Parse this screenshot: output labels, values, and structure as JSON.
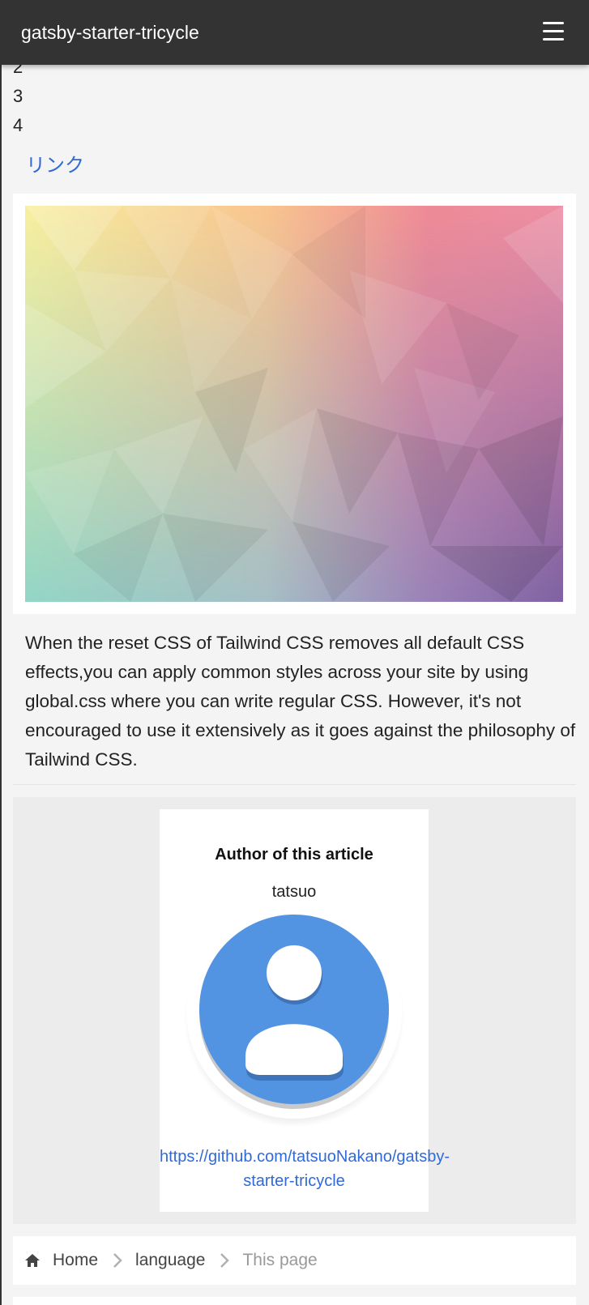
{
  "header": {
    "site_title": "gatsby-starter-tricycle",
    "menu_icon": "hamburger-menu-icon"
  },
  "article": {
    "list_numbers": [
      "2",
      "3",
      "4"
    ],
    "link_text": "リンク",
    "hero_image": "low-poly-pastel-gradient",
    "paragraph": "When the reset CSS of Tailwind CSS removes all default CSS effects,you can apply common styles across your site by using global.css where you can write regular CSS. However, it's not encouraged to use it extensively as it goes against the philosophy of Tailwind CSS."
  },
  "author": {
    "heading": "Author of this article",
    "name": "tatsuo",
    "avatar_icon": "user-avatar-icon",
    "link_line1": "https://github.com/tatsuoNakano/gatsby-",
    "link_line2": "starter-tricycle"
  },
  "breadcrumb": {
    "home_icon": "home-icon",
    "separator_icon": "chevron-right-icon",
    "items": [
      {
        "label": "Home"
      },
      {
        "label": "language"
      },
      {
        "label": "This page"
      }
    ]
  },
  "colors": {
    "header_bg": "#333333",
    "link": "#2f6ad8",
    "avatar_blue": "#5294e2",
    "page_bg": "#f4f4f4"
  }
}
